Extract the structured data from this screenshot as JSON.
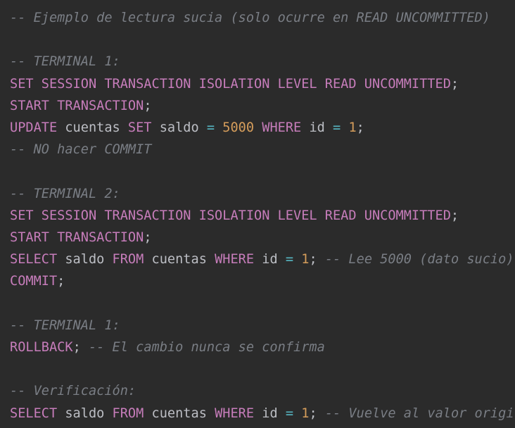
{
  "editor": {
    "lines": [
      {
        "tokens": [
          {
            "t": "cmt",
            "v": "-- Ejemplo de lectura sucia (solo ocurre en READ UNCOMMITTED)"
          }
        ]
      },
      {
        "tokens": []
      },
      {
        "tokens": [
          {
            "t": "cmt",
            "v": "-- TERMINAL 1:"
          }
        ]
      },
      {
        "tokens": [
          {
            "t": "kw",
            "v": "SET SESSION TRANSACTION ISOLATION LEVEL READ UNCOMMITTED"
          },
          {
            "t": "pn",
            "v": ";"
          }
        ]
      },
      {
        "tokens": [
          {
            "t": "kw",
            "v": "START TRANSACTION"
          },
          {
            "t": "pn",
            "v": ";"
          }
        ]
      },
      {
        "tokens": [
          {
            "t": "kw",
            "v": "UPDATE"
          },
          {
            "t": "id",
            "v": " cuentas "
          },
          {
            "t": "kw",
            "v": "SET"
          },
          {
            "t": "id",
            "v": " saldo "
          },
          {
            "t": "op",
            "v": "="
          },
          {
            "t": "id",
            "v": " "
          },
          {
            "t": "lit",
            "v": "5000"
          },
          {
            "t": "id",
            "v": " "
          },
          {
            "t": "kw",
            "v": "WHERE"
          },
          {
            "t": "id",
            "v": " id "
          },
          {
            "t": "op",
            "v": "="
          },
          {
            "t": "id",
            "v": " "
          },
          {
            "t": "lit",
            "v": "1"
          },
          {
            "t": "pn",
            "v": ";"
          }
        ]
      },
      {
        "tokens": [
          {
            "t": "cmt",
            "v": "-- NO hacer COMMIT"
          }
        ]
      },
      {
        "tokens": []
      },
      {
        "tokens": [
          {
            "t": "cmt",
            "v": "-- TERMINAL 2:"
          }
        ]
      },
      {
        "tokens": [
          {
            "t": "kw",
            "v": "SET SESSION TRANSACTION ISOLATION LEVEL READ UNCOMMITTED"
          },
          {
            "t": "pn",
            "v": ";"
          }
        ]
      },
      {
        "tokens": [
          {
            "t": "kw",
            "v": "START TRANSACTION"
          },
          {
            "t": "pn",
            "v": ";"
          }
        ]
      },
      {
        "tokens": [
          {
            "t": "kw",
            "v": "SELECT"
          },
          {
            "t": "id",
            "v": " saldo "
          },
          {
            "t": "kw",
            "v": "FROM"
          },
          {
            "t": "id",
            "v": " cuentas "
          },
          {
            "t": "kw",
            "v": "WHERE"
          },
          {
            "t": "id",
            "v": " id "
          },
          {
            "t": "op",
            "v": "="
          },
          {
            "t": "id",
            "v": " "
          },
          {
            "t": "lit",
            "v": "1"
          },
          {
            "t": "pn",
            "v": "; "
          },
          {
            "t": "cmt",
            "v": "-- Lee 5000 (dato sucio)"
          }
        ]
      },
      {
        "tokens": [
          {
            "t": "kw",
            "v": "COMMIT"
          },
          {
            "t": "pn",
            "v": ";"
          }
        ]
      },
      {
        "tokens": []
      },
      {
        "tokens": [
          {
            "t": "cmt",
            "v": "-- TERMINAL 1:"
          }
        ]
      },
      {
        "tokens": [
          {
            "t": "kw",
            "v": "ROLLBACK"
          },
          {
            "t": "pn",
            "v": "; "
          },
          {
            "t": "cmt",
            "v": "-- El cambio nunca se confirma"
          }
        ]
      },
      {
        "tokens": []
      },
      {
        "tokens": [
          {
            "t": "cmt",
            "v": "-- Verificación:"
          }
        ]
      },
      {
        "tokens": [
          {
            "t": "kw",
            "v": "SELECT"
          },
          {
            "t": "id",
            "v": " saldo "
          },
          {
            "t": "kw",
            "v": "FROM"
          },
          {
            "t": "id",
            "v": " cuentas "
          },
          {
            "t": "kw",
            "v": "WHERE"
          },
          {
            "t": "id",
            "v": " id "
          },
          {
            "t": "op",
            "v": "="
          },
          {
            "t": "id",
            "v": " "
          },
          {
            "t": "lit",
            "v": "1"
          },
          {
            "t": "pn",
            "v": "; "
          },
          {
            "t": "cmt",
            "v": "-- Vuelve al valor origi"
          }
        ]
      }
    ]
  },
  "colors": {
    "background": "#2b2b2b",
    "keyword": "#c77dbb",
    "number": "#d59d5b",
    "operator": "#56b6c2",
    "comment": "#7a7e85",
    "identifier": "#bcbec4"
  }
}
